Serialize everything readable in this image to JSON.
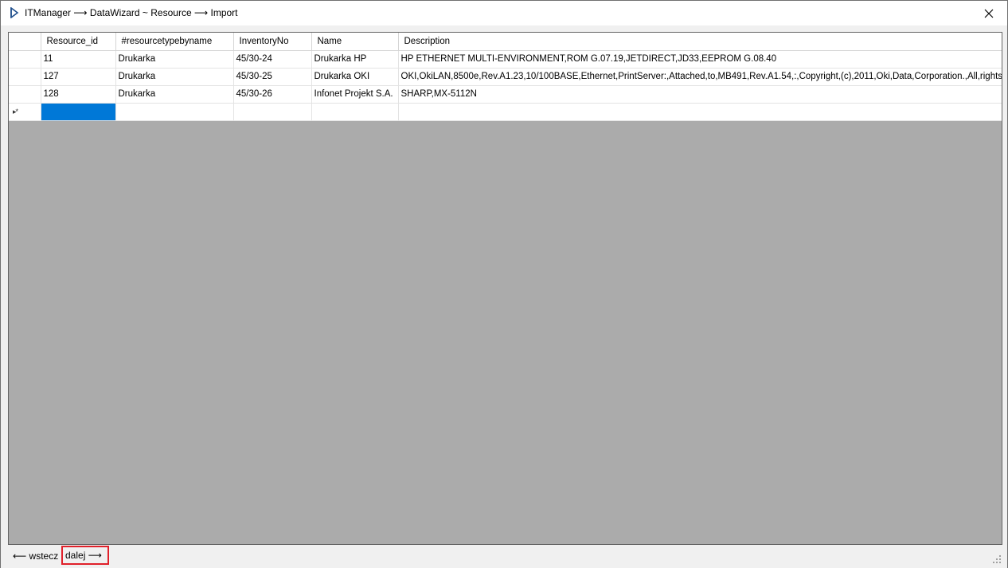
{
  "window": {
    "title": "ITManager ⟶ DataWizard ~ Resource ⟶ Import"
  },
  "grid": {
    "columns": [
      "Resource_id",
      "#resourcetypebyname",
      "InventoryNo",
      "Name",
      "Description"
    ],
    "rows": [
      [
        "11",
        "Drukarka",
        "45/30-24",
        "Drukarka HP",
        "HP ETHERNET MULTI-ENVIRONMENT,ROM G.07.19,JETDIRECT,JD33,EEPROM G.08.40"
      ],
      [
        "127",
        "Drukarka",
        "45/30-25",
        "Drukarka OKI",
        "OKI,OkiLAN,8500e,Rev.A1.23,10/100BASE,Ethernet,PrintServer:,Attached,to,MB491,Rev.A1.54,:,Copyright,(c),2011,Oki,Data,Corporation.,All,rights,reserved."
      ],
      [
        "128",
        "Drukarka",
        "45/30-26",
        "Infonet Projekt S.A.",
        "SHARP,MX-5112N"
      ]
    ],
    "new_row_marker": "▸*"
  },
  "footer": {
    "back_label": "⟵ wstecz",
    "next_label": "dalej ⟶"
  },
  "colors": {
    "selection": "#0078d7",
    "highlight_border": "#e0202a",
    "grid_background": "#ababab"
  },
  "icons": {
    "app": "app-logo-icon",
    "close": "close-icon",
    "resize": "resize-grip-icon"
  }
}
